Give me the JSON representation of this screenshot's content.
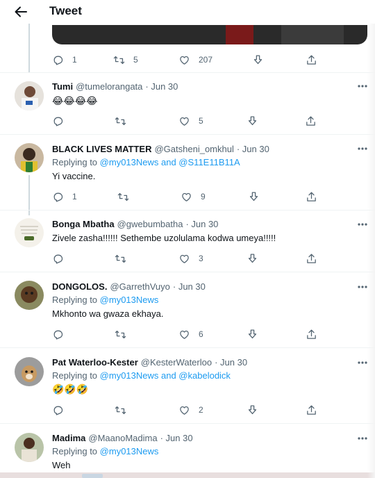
{
  "header": {
    "title": "Tweet"
  },
  "top_tweet": {
    "counts": {
      "replies": "1",
      "retweets": "5",
      "likes": "207"
    }
  },
  "tweets": [
    {
      "name": "Tumi",
      "handle": "@tumelorangata",
      "date": "· Jun 30",
      "reply_to": null,
      "text": "😂😂😂😂",
      "counts": {
        "replies": "",
        "retweets": "",
        "likes": "5"
      }
    },
    {
      "name": "BLACK LIVES MATTER",
      "handle": "@Gatsheni_omkhul",
      "date": "· Jun 30",
      "reply_to": {
        "prefix": "Replying to",
        "targets": "@my013News and @S11E11B11A"
      },
      "text": "Yi vaccine.",
      "counts": {
        "replies": "1",
        "retweets": "",
        "likes": "9"
      }
    },
    {
      "name": "Bonga Mbatha",
      "handle": "@gwebumbatha",
      "date": "· Jun 30",
      "reply_to": null,
      "text": "Zivele zasha!!!!!! Sethembe uzolulama kodwa umeya!!!!!",
      "counts": {
        "replies": "",
        "retweets": "",
        "likes": "3"
      }
    },
    {
      "name": "DONGOLOS.",
      "handle": "@GarrethVuyo",
      "date": "· Jun 30",
      "reply_to": {
        "prefix": "Replying to",
        "targets": "@my013News"
      },
      "text": "Mkhonto wa gwaza ekhaya.",
      "counts": {
        "replies": "",
        "retweets": "",
        "likes": "6"
      }
    },
    {
      "name": "Pat Waterloo-Kester",
      "handle": "@KesterWaterloo",
      "date": "· Jun 30",
      "reply_to": {
        "prefix": "Replying to",
        "targets": "@my013News and @kabelodick"
      },
      "text": "🤣🤣🤣",
      "counts": {
        "replies": "",
        "retweets": "",
        "likes": "2"
      }
    },
    {
      "name": "Madima",
      "handle": "@MaanoMadima",
      "date": "· Jun 30",
      "reply_to": {
        "prefix": "Replying to",
        "targets": "@my013News"
      },
      "text": "Weh",
      "counts": null
    }
  ],
  "colors": {
    "link": "#1d9bf0",
    "muted": "#536471",
    "text": "#0f1419",
    "divider": "#eff3f4"
  },
  "icons": [
    "back-arrow-icon",
    "reply-icon",
    "retweet-icon",
    "like-icon",
    "download-icon",
    "share-icon",
    "more-icon"
  ]
}
